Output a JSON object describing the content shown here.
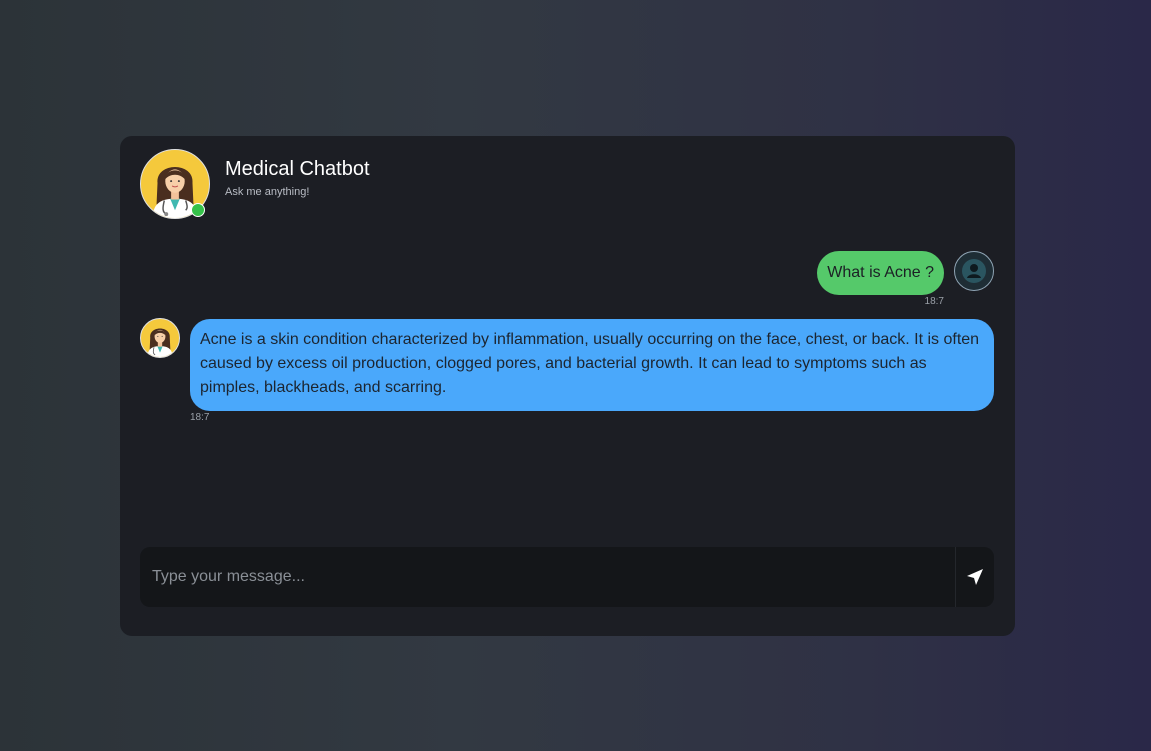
{
  "header": {
    "title": "Medical Chatbot",
    "subtitle": "Ask me anything!",
    "status": "online"
  },
  "messages": [
    {
      "sender": "user",
      "text": "What is Acne ?",
      "time": "18:7"
    },
    {
      "sender": "bot",
      "text": "Acne is a skin condition characterized by inflammation, usually occurring on the face, chest, or back. It is often caused by excess oil production, clogged pores, and bacterial growth. It can lead to symptoms such as pimples, blackheads, and scarring.",
      "time": "18:7"
    }
  ],
  "input": {
    "placeholder": "Type your message...",
    "value": ""
  },
  "icons": {
    "send": "send-icon",
    "user_avatar": "user-icon",
    "bot_avatar": "doctor-icon"
  },
  "colors": {
    "user_bubble": "#55c96a",
    "bot_bubble": "#4aa8fb",
    "online_dot": "#35c24a",
    "card_bg": "#1c1e24"
  }
}
